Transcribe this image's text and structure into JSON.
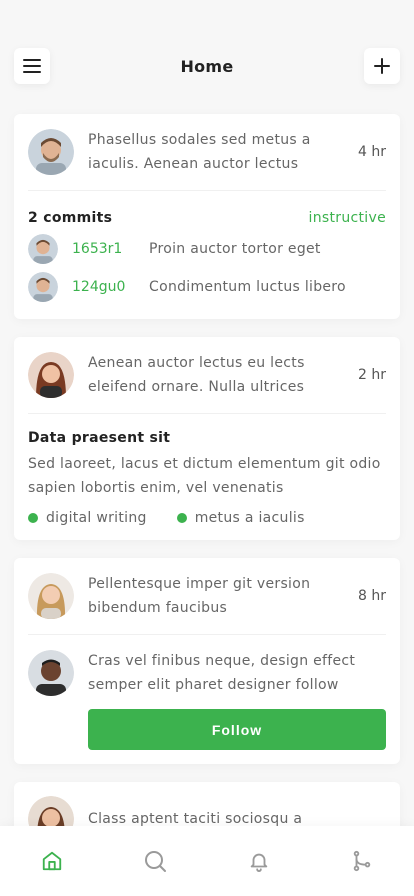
{
  "header": {
    "title": "Home",
    "menu_icon": "menu-icon",
    "add_icon": "plus-icon"
  },
  "posts": [
    {
      "text": "Phasellus sodales sed metus a iaculis. Aenean auctor lectus",
      "time": "4 hr",
      "commits_label": "2 commits",
      "tag": "instructive",
      "commits": [
        {
          "id": "1653r1",
          "message": "Proin auctor tortor eget"
        },
        {
          "id": "124gu0",
          "message": "Condimentum luctus libero"
        }
      ]
    },
    {
      "text": "Aenean auctor lectus eu lects eleifend ornare. Nulla ultrices",
      "time": "2 hr",
      "title": "Data praesent sit",
      "body": "Sed laoreet, lacus et dictum elementum git odio sapien lobortis enim, vel venenatis",
      "tags": [
        "digital writing",
        "metus a iaculis"
      ]
    },
    {
      "text": "Pellentesque imper git version bibendum faucibus",
      "time": "8 hr",
      "suggestion": "Cras vel finibus neque, design effect semper elit pharet designer follow",
      "follow_label": "Follow"
    },
    {
      "text": "Class aptent taciti sociosqu a"
    }
  ],
  "tabbar": {
    "icons": [
      "home-icon",
      "search-icon",
      "bell-icon",
      "git-branch-icon"
    ],
    "active": "home-icon",
    "active_color": "#3cb24e",
    "inactive_color": "#9a9a9a"
  },
  "colors": {
    "accent": "#3cb24e",
    "background": "#f7f7f7"
  }
}
